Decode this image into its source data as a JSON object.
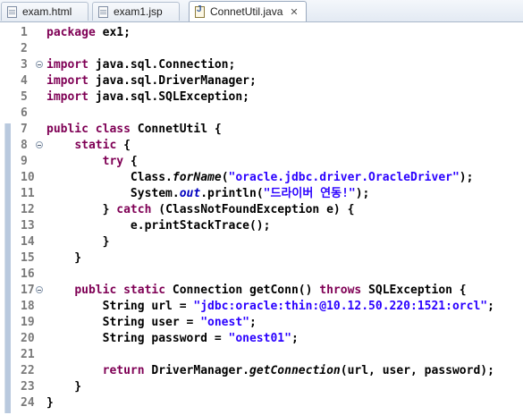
{
  "tabs": [
    {
      "label": "exam.html",
      "type": "html"
    },
    {
      "label": "exam1.jsp",
      "type": "jsp"
    },
    {
      "label": "ConnetUtil.java",
      "type": "java",
      "active": true,
      "close": "✕"
    }
  ],
  "editor": {
    "lines": [
      {
        "n": "1",
        "tokens": [
          {
            "t": "package",
            "c": "kw"
          },
          {
            "t": " ex1;"
          }
        ]
      },
      {
        "n": "2",
        "tokens": []
      },
      {
        "n": "3",
        "fold": true,
        "tokens": [
          {
            "t": "import",
            "c": "kw"
          },
          {
            "t": " java.sql.Connection;"
          }
        ]
      },
      {
        "n": "4",
        "tokens": [
          {
            "t": "import",
            "c": "kw"
          },
          {
            "t": " java.sql.DriverManager;"
          }
        ]
      },
      {
        "n": "5",
        "tokens": [
          {
            "t": "import",
            "c": "kw"
          },
          {
            "t": " java.sql.SQLException;"
          }
        ]
      },
      {
        "n": "6",
        "tokens": []
      },
      {
        "n": "7",
        "tokens": [
          {
            "t": "public",
            "c": "kw"
          },
          {
            "t": " "
          },
          {
            "t": "class",
            "c": "kw"
          },
          {
            "t": " ConnetUtil {"
          }
        ]
      },
      {
        "n": "8",
        "fold": true,
        "tokens": [
          {
            "t": "    "
          },
          {
            "t": "static",
            "c": "kw"
          },
          {
            "t": " {"
          }
        ]
      },
      {
        "n": "9",
        "tokens": [
          {
            "t": "        "
          },
          {
            "t": "try",
            "c": "kw"
          },
          {
            "t": " {"
          }
        ]
      },
      {
        "n": "10",
        "tokens": [
          {
            "t": "            Class."
          },
          {
            "t": "forName",
            "c": "it"
          },
          {
            "t": "("
          },
          {
            "t": "\"oracle.jdbc.driver.OracleDriver\"",
            "c": "str"
          },
          {
            "t": ");"
          }
        ]
      },
      {
        "n": "11",
        "tokens": [
          {
            "t": "            System."
          },
          {
            "t": "out",
            "c": "fld"
          },
          {
            "t": ".println("
          },
          {
            "t": "\"드라이버 연동!\"",
            "c": "str"
          },
          {
            "t": ");"
          }
        ]
      },
      {
        "n": "12",
        "tokens": [
          {
            "t": "        } "
          },
          {
            "t": "catch",
            "c": "kw"
          },
          {
            "t": " (ClassNotFoundException e) {"
          }
        ]
      },
      {
        "n": "13",
        "tokens": [
          {
            "t": "            e.printStackTrace();"
          }
        ]
      },
      {
        "n": "14",
        "tokens": [
          {
            "t": "        }"
          }
        ]
      },
      {
        "n": "15",
        "tokens": [
          {
            "t": "    }"
          }
        ]
      },
      {
        "n": "16",
        "tokens": []
      },
      {
        "n": "17",
        "fold": true,
        "tokens": [
          {
            "t": "    "
          },
          {
            "t": "public",
            "c": "kw"
          },
          {
            "t": " "
          },
          {
            "t": "static",
            "c": "kw"
          },
          {
            "t": " Connection getConn() "
          },
          {
            "t": "throws",
            "c": "kw"
          },
          {
            "t": " SQLException {"
          }
        ]
      },
      {
        "n": "18",
        "tokens": [
          {
            "t": "        String url = "
          },
          {
            "t": "\"jdbc:oracle:thin:@10.12.50.220:1521:orcl\"",
            "c": "str"
          },
          {
            "t": ";"
          }
        ]
      },
      {
        "n": "19",
        "tokens": [
          {
            "t": "        String user = "
          },
          {
            "t": "\"onest\"",
            "c": "str"
          },
          {
            "t": ";"
          }
        ]
      },
      {
        "n": "20",
        "tokens": [
          {
            "t": "        String password = "
          },
          {
            "t": "\"onest01\"",
            "c": "str"
          },
          {
            "t": ";"
          }
        ]
      },
      {
        "n": "21",
        "tokens": []
      },
      {
        "n": "22",
        "tokens": [
          {
            "t": "        "
          },
          {
            "t": "return",
            "c": "kw"
          },
          {
            "t": " DriverManager."
          },
          {
            "t": "getConnection",
            "c": "it"
          },
          {
            "t": "(url, user, password);"
          }
        ]
      },
      {
        "n": "23",
        "tokens": [
          {
            "t": "    }"
          }
        ]
      },
      {
        "n": "24",
        "tokens": [
          {
            "t": "}"
          }
        ]
      }
    ]
  },
  "colors": {
    "keyword": "#7f0055",
    "string": "#2a00ff",
    "field": "#0000c0",
    "change_marker": "#b9c9de"
  }
}
